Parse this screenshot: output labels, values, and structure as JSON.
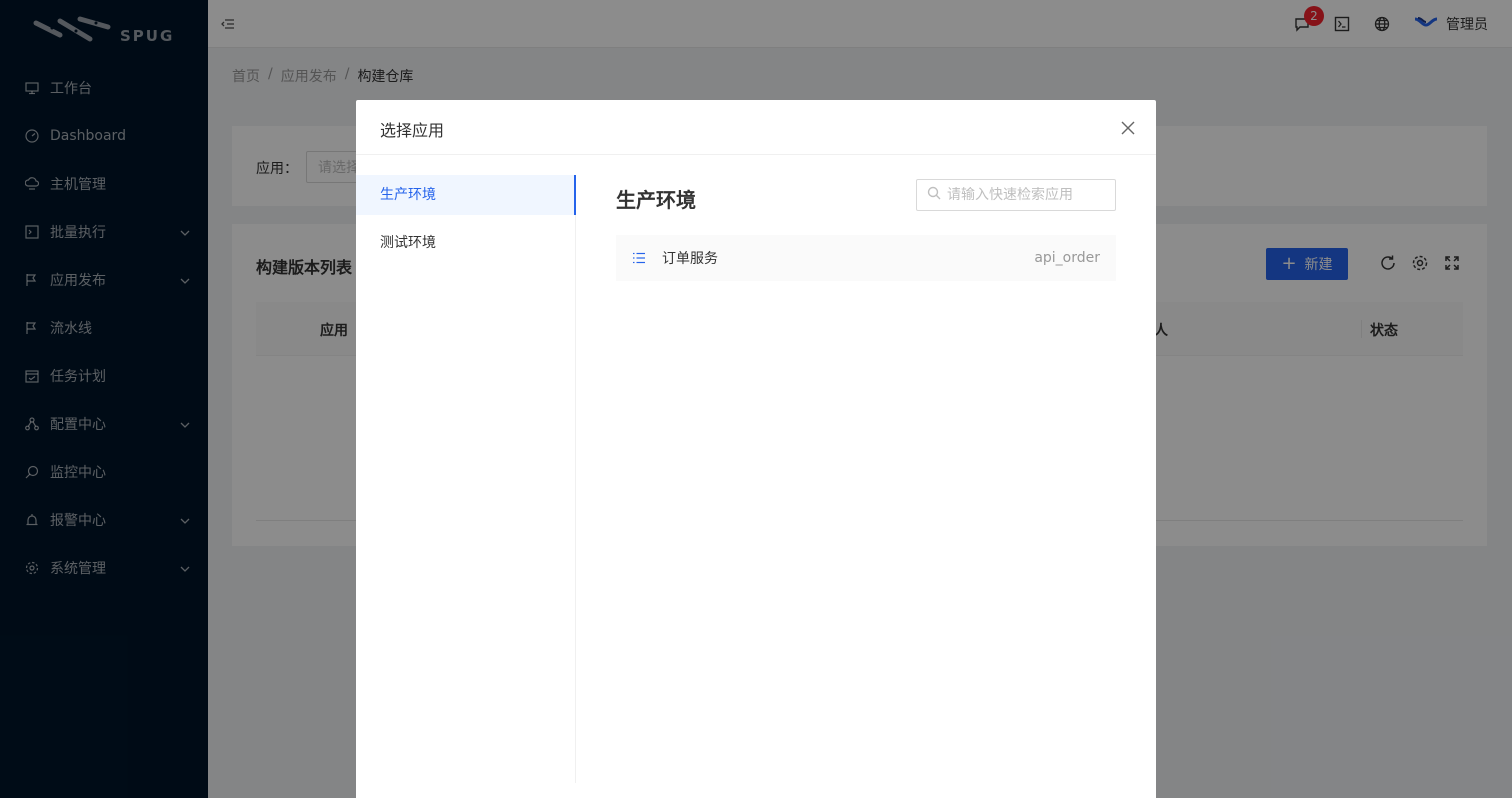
{
  "app": {
    "logo_text": "SPUG"
  },
  "sidebar": {
    "items": [
      {
        "label": "工作台",
        "icon": "desktop-icon",
        "has_children": false
      },
      {
        "label": "Dashboard",
        "icon": "dashboard-icon",
        "has_children": false
      },
      {
        "label": "主机管理",
        "icon": "cloud-server-icon",
        "has_children": false
      },
      {
        "label": "批量执行",
        "icon": "code-icon",
        "has_children": true
      },
      {
        "label": "应用发布",
        "icon": "flag-icon",
        "has_children": true
      },
      {
        "label": "流水线",
        "icon": "flag-icon",
        "has_children": false
      },
      {
        "label": "任务计划",
        "icon": "schedule-icon",
        "has_children": false
      },
      {
        "label": "配置中心",
        "icon": "deployment-icon",
        "has_children": true
      },
      {
        "label": "监控中心",
        "icon": "monitor-icon",
        "has_children": false
      },
      {
        "label": "报警中心",
        "icon": "alert-icon",
        "has_children": true
      },
      {
        "label": "系统管理",
        "icon": "setting-icon",
        "has_children": true
      }
    ]
  },
  "header": {
    "notification_count": "2",
    "user_name": "管理员"
  },
  "breadcrumb": {
    "home": "首页",
    "parent": "应用发布",
    "current": "构建仓库",
    "sep": "/"
  },
  "filter": {
    "label": "应用：",
    "placeholder": "请选择"
  },
  "list": {
    "title": "构建版本列表",
    "new_button": "新建",
    "columns": {
      "app": "应用",
      "person": "人",
      "status": "状态"
    }
  },
  "modal": {
    "title": "选择应用",
    "environments": [
      {
        "label": "生产环境",
        "active": true
      },
      {
        "label": "测试环境",
        "active": false
      }
    ],
    "panel_title": "生产环境",
    "search_placeholder": "请输入快速检索应用",
    "apps": [
      {
        "name": "订单服务",
        "key": "api_order"
      }
    ]
  },
  "colors": {
    "primary": "#2563eb",
    "sidebar_bg": "#001529",
    "badge": "#f5222d"
  }
}
